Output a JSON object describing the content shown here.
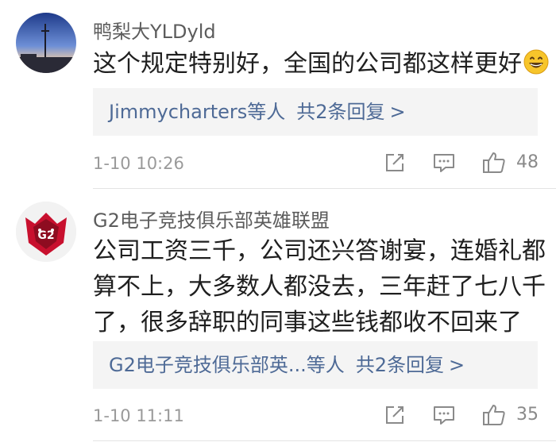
{
  "comments": [
    {
      "username": "鸭梨大YLDyld",
      "body_lines": [
        "这个规定特别好，全国的公司都这样更好"
      ],
      "emoji": "grinning-face-emoji",
      "reply": {
        "names": "Jimmycharters",
        "suffix": "等人",
        "count_label": "共2条回复",
        "chevron": ">"
      },
      "timestamp": "1-10 10:26",
      "likes": "48",
      "icons": {
        "share": "share-icon",
        "comment": "comment-icon",
        "like": "thumbs-up-icon"
      }
    },
    {
      "username": "G2电子竞技俱乐部英雄联盟",
      "body_lines": [
        "公司工资三千，公司还兴答谢宴，连婚礼都",
        "算不上，大多数人都没去，三年赶了七八千",
        "了，很多辞职的同事这些钱都收不回来了"
      ],
      "reply": {
        "names": "G2电子竞技俱乐部英...",
        "suffix": "等人",
        "count_label": "共2条回复",
        "chevron": ">"
      },
      "timestamp": "1-10 11:11",
      "likes": "35",
      "icons": {
        "share": "share-icon",
        "comment": "comment-icon",
        "like": "thumbs-up-icon"
      }
    }
  ],
  "colors": {
    "link": "#4e6a96",
    "reply_bg": "#f4f4f4",
    "meta_gray": "#9a9a9a",
    "g2_red": "#c8102e"
  }
}
